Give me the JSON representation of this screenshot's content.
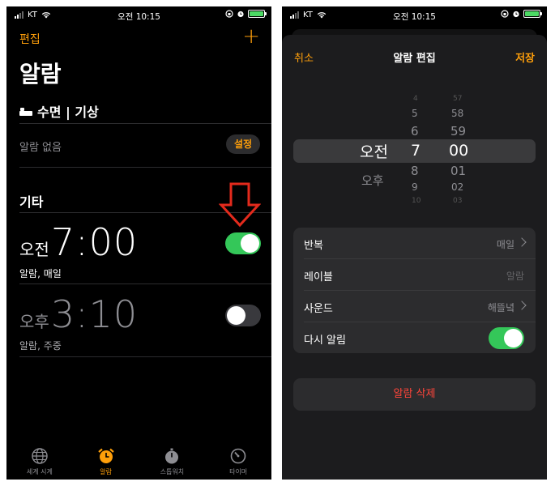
{
  "status_bar": {
    "carrier": "KT",
    "time": "오전 10:15"
  },
  "alarms_screen": {
    "edit_label": "편집",
    "add_label": "+",
    "title": "알람",
    "sleep_section": {
      "title": "수면 | 기상",
      "no_alarm_text": "알람 없음",
      "setup_label": "설정"
    },
    "other_section_title": "기타",
    "alarms": [
      {
        "period": "오전",
        "time": "7:00",
        "detail": "알람, 매일",
        "enabled": true
      },
      {
        "period": "오후",
        "time": "3:10",
        "detail": "알람, 주중",
        "enabled": false
      }
    ],
    "tabs": [
      {
        "label": "세계 시계",
        "icon": "globe-icon",
        "active": false
      },
      {
        "label": "알람",
        "icon": "alarm-clock-icon",
        "active": true
      },
      {
        "label": "스톱워치",
        "icon": "stopwatch-icon",
        "active": false
      },
      {
        "label": "타이머",
        "icon": "timer-icon",
        "active": false
      }
    ]
  },
  "edit_screen": {
    "cancel_label": "취소",
    "title": "알람 편집",
    "save_label": "저장",
    "picker": {
      "period_options": [
        "오전",
        "오후"
      ],
      "selected_period": "오전",
      "hours": [
        "4",
        "5",
        "6",
        "7",
        "8",
        "9",
        "10"
      ],
      "selected_hour": "7",
      "minutes": [
        "57",
        "58",
        "59",
        "00",
        "01",
        "02",
        "03"
      ],
      "selected_minute": "00"
    },
    "options": {
      "repeat": {
        "label": "반복",
        "value": "매일"
      },
      "label_field": {
        "label": "레이블",
        "value": "알람"
      },
      "sound": {
        "label": "사운드",
        "value": "해뜰녘"
      },
      "snooze": {
        "label": "다시 알림",
        "enabled": true
      }
    },
    "delete_label": "알람 삭제"
  },
  "colors": {
    "accent": "#ff9f0a",
    "toggle_on": "#34c759",
    "destructive": "#ff453a",
    "annotation": "#e32a1c"
  }
}
